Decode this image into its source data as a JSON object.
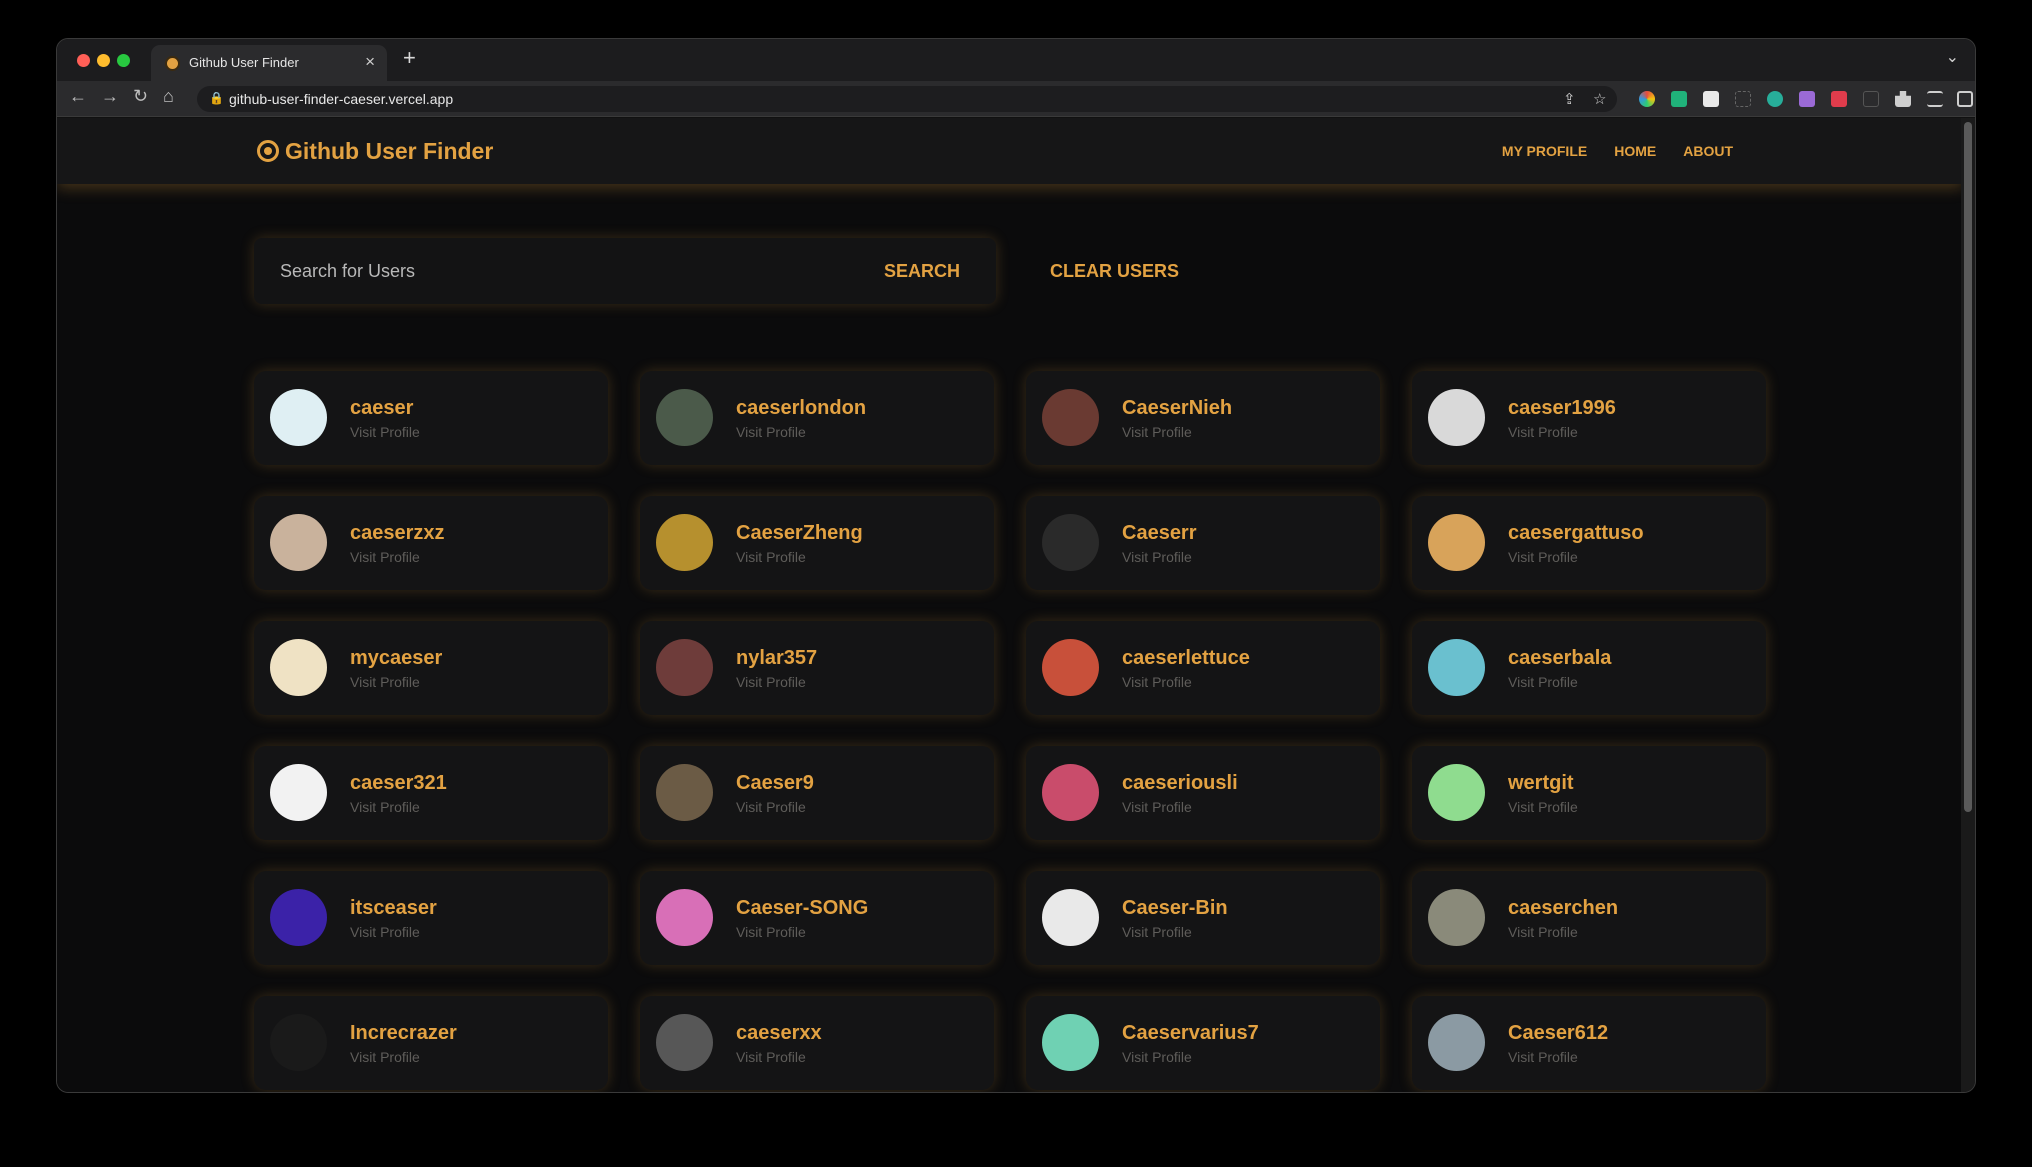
{
  "browser": {
    "tab_title": "Github User Finder",
    "tab_close": "×",
    "new_tab": "+",
    "tab_menu": "⌄",
    "url": "github-user-finder-caeser.vercel.app",
    "nav": {
      "back": "←",
      "forward": "→",
      "reload": "↻",
      "home": "⌂"
    },
    "omnibox_icons": {
      "share": "⇪",
      "bookmark": "☆"
    }
  },
  "header": {
    "brand": "Github User Finder",
    "links": [
      "MY PROFILE",
      "HOME",
      "ABOUT"
    ]
  },
  "search": {
    "placeholder": "Search for Users",
    "button": "SEARCH",
    "clear": "CLEAR USERS"
  },
  "card_link_text": "Visit Profile",
  "users": [
    {
      "name": "caeser",
      "avatar_color": "#dfeff3"
    },
    {
      "name": "caeserlondon",
      "avatar_color": "#4b5a4a"
    },
    {
      "name": "CaeserNieh",
      "avatar_color": "#6a3a32"
    },
    {
      "name": "caeser1996",
      "avatar_color": "#d9d9d9"
    },
    {
      "name": "caeserzxz",
      "avatar_color": "#c9b29c"
    },
    {
      "name": "CaeserZheng",
      "avatar_color": "#b6902e"
    },
    {
      "name": "Caeserr",
      "avatar_color": "#2a2a2a"
    },
    {
      "name": "caesergattuso",
      "avatar_color": "#d8a35a"
    },
    {
      "name": "mycaeser",
      "avatar_color": "#efe2c4"
    },
    {
      "name": "nylar357",
      "avatar_color": "#6e3c3a"
    },
    {
      "name": "caeserlettuce",
      "avatar_color": "#c8503a"
    },
    {
      "name": "caeserbala",
      "avatar_color": "#6ac0cf"
    },
    {
      "name": "caeser321",
      "avatar_color": "#f2f2f2"
    },
    {
      "name": "Caeser9",
      "avatar_color": "#6b5b45"
    },
    {
      "name": "caeseriousli",
      "avatar_color": "#c94c6b"
    },
    {
      "name": "wertgit",
      "avatar_color": "#8fdc8f"
    },
    {
      "name": "itsceaser",
      "avatar_color": "#3b22a8"
    },
    {
      "name": "Caeser-SONG",
      "avatar_color": "#d86fb7"
    },
    {
      "name": "Caeser-Bin",
      "avatar_color": "#e9e9e9"
    },
    {
      "name": "caeserchen",
      "avatar_color": "#8a8a7a"
    },
    {
      "name": "Increcrazer",
      "avatar_color": "#1a1a1a"
    },
    {
      "name": "caeserxx",
      "avatar_color": "#575757"
    },
    {
      "name": "Caeservarius7",
      "avatar_color": "#6fd1b3"
    },
    {
      "name": "Caeser612",
      "avatar_color": "#8b9aa3"
    }
  ]
}
